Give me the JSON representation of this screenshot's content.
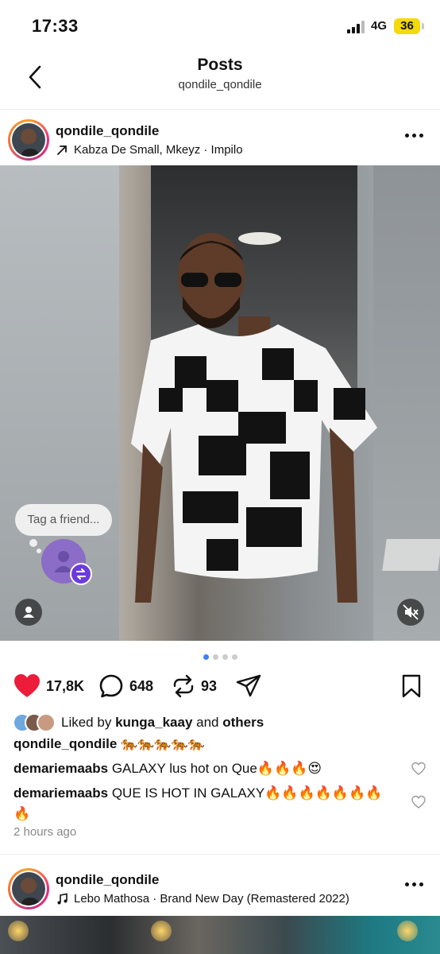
{
  "status_bar": {
    "time": "17:33",
    "network": "4G",
    "battery": "36"
  },
  "header": {
    "title": "Posts",
    "subtitle": "qondile_qondile"
  },
  "post1": {
    "username": "qondile_qondile",
    "music": "Kabza De Small, Mkeyz · Impilo",
    "tag_prompt": "Tag a friend...",
    "carousel": {
      "count": 4,
      "active": 1
    },
    "likes_count": "17,8K",
    "comments_count": "648",
    "reposts_count": "93",
    "liked_by_prefix": "Liked by",
    "liked_by_user": "kunga_kaay",
    "liked_by_and": "and",
    "liked_by_others": "others",
    "caption_user": "qondile_qondile",
    "caption_text": "🐅🐅🐅🐅🐅",
    "comments": [
      {
        "user": "demariemaabs",
        "text": "GALAXY lus hot on Que🔥🔥🔥😍"
      },
      {
        "user": "demariemaabs",
        "text": "QUE IS HOT IN GALAXY🔥🔥🔥🔥🔥🔥🔥🔥"
      }
    ],
    "time_ago": "2 hours ago"
  },
  "post2": {
    "username": "qondile_qondile",
    "music": "Lebo Mathosa · Brand New Day (Remastered 2022)"
  },
  "colors": {
    "like_red": "#ed1c3a",
    "active_dot": "#3b82f6",
    "tag_purple": "#6c3bdc",
    "battery": "#f5d90a"
  }
}
